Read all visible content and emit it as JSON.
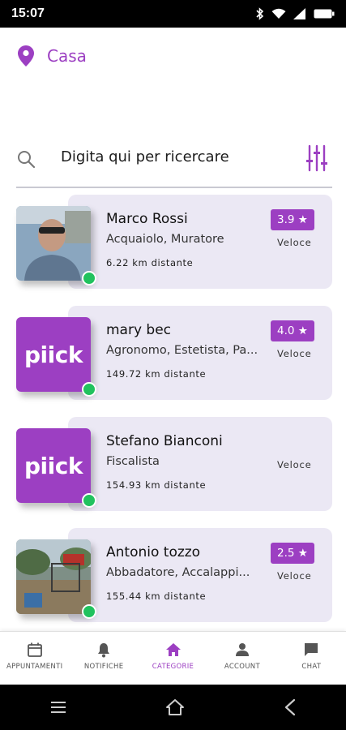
{
  "status_bar": {
    "time": "15:07"
  },
  "location": {
    "label": "Casa"
  },
  "search": {
    "placeholder": "Digita qui per ricercare"
  },
  "professionals": [
    {
      "name": "Marco Rossi",
      "categories": "Acquaiolo, Muratore",
      "distance": "6.22 km distante",
      "rating": "3.9 ★",
      "speed": "Veloce",
      "avatar": "photo-man"
    },
    {
      "name": "mary bec",
      "categories": "Agronomo, Estetista, Pa...",
      "distance": "149.72 km distante",
      "rating": "4.0 ★",
      "speed": "Veloce",
      "avatar": "piick-logo",
      "logo_text": "piick"
    },
    {
      "name": "Stefano Bianconi",
      "categories": "Fiscalista",
      "distance": "154.93 km distante",
      "rating": "",
      "speed": "Veloce",
      "avatar": "piick-logo",
      "logo_text": "piick"
    },
    {
      "name": "Antonio tozzo",
      "categories": "Abbadatore, Accalappi...",
      "distance": "155.44 km distante",
      "rating": "2.5 ★",
      "speed": "Veloce",
      "avatar": "photo-outdoor"
    }
  ],
  "bottom_nav": [
    {
      "label": "APPUNTAMENTI",
      "icon": "calendar-icon",
      "active": false
    },
    {
      "label": "NOTIFICHE",
      "icon": "bell-icon",
      "active": false
    },
    {
      "label": "CATEGORIE",
      "icon": "home-icon",
      "active": true
    },
    {
      "label": "ACCOUNT",
      "icon": "person-icon",
      "active": false
    },
    {
      "label": "CHAT",
      "icon": "chat-icon",
      "active": false
    }
  ],
  "colors": {
    "accent": "#9c3fc2",
    "card_bg": "#ebe8f4",
    "online": "#21c25e"
  }
}
